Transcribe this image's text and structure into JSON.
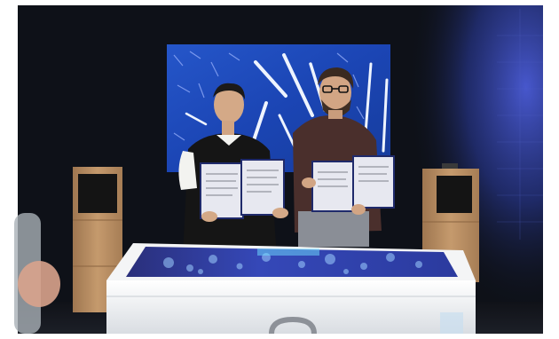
{
  "photo": {
    "alt": "",
    "colors": {
      "frame": "#ffffff",
      "wall": "#0d1016",
      "backdrop_panel": "#1b4ab8",
      "light_tube": "#e9f2ff",
      "right_wall_light": "#3344aa",
      "speaker_wood": "#b88a5c",
      "table_white": "#f1f2f3",
      "table_screen": "#2a3ca8",
      "document_cover": "#e8e8ef",
      "vest_black": "#151515",
      "shirt_brown": "#4a2f2c"
    },
    "subjects": [
      {
        "id": "person-left",
        "icon": "person"
      },
      {
        "id": "person-right",
        "icon": "person"
      }
    ],
    "objects": [
      "backdrop-led-panel",
      "speaker-left",
      "speaker-right",
      "touch-table",
      "signed-documents"
    ]
  }
}
